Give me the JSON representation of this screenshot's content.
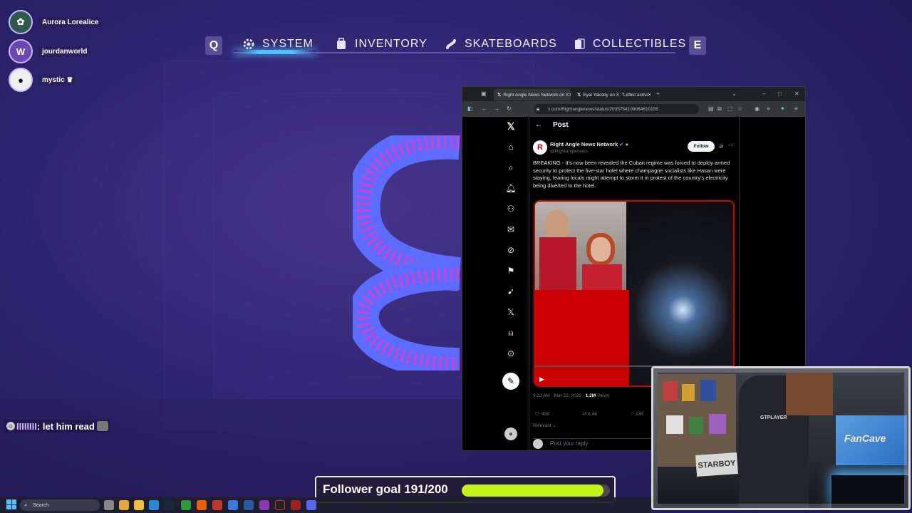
{
  "viewers": [
    {
      "name": "Aurora Lorealice"
    },
    {
      "name": "jourdanworld"
    },
    {
      "name": "mystic ♛"
    }
  ],
  "menu": {
    "left_key": "Q",
    "right_key": "E",
    "tabs": [
      {
        "label": "SYSTEM",
        "icon": "gear-icon",
        "active": true
      },
      {
        "label": "INVENTORY",
        "icon": "backpack-icon",
        "active": false
      },
      {
        "label": "SKATEBOARDS",
        "icon": "skateboard-icon",
        "active": false
      },
      {
        "label": "COLLECTIBLES",
        "icon": "cards-icon",
        "active": false
      }
    ],
    "accent_color": "#4fc3ff"
  },
  "browser": {
    "tabs": [
      {
        "title": "Right Angle News Network on X",
        "active": true
      },
      {
        "title": "Eyal Yakoby on X: \"Leftist activi",
        "active": false
      }
    ],
    "url": "x.com/Rightanglenews/status/2035754109064610155"
  },
  "x_post": {
    "header": "Post",
    "author_name": "Right Angle News Network",
    "author_handle": "@Rightanglenews",
    "follow_label": "Follow",
    "text": "BREAKING - It's now been revealed the Cuban regime was forced to deploy armed security to protect the five-star hotel where champagne socialists like Hasan were staying, fearing locals might attempt to storm it in protest of the country's electricity being diverted to the hotel.",
    "timestamp": "9:22 AM · Mar 22, 2026 · ",
    "views_count": "1.2M",
    "views_label": " Views",
    "replies": "499",
    "reposts": "6.4K",
    "likes": "33K",
    "sort_label": "Relevant ⌄",
    "reply_placeholder": "Post your reply"
  },
  "chat": {
    "user": "IIIIIIII",
    "message": "let him read"
  },
  "follower_goal": {
    "label": "Follower goal 191/200",
    "current": 191,
    "target": 200,
    "fill_color": "#c5f018"
  },
  "taskbar": {
    "search_placeholder": "Search"
  },
  "webcam": {
    "chair_brand": "GTPLAYER",
    "plate_text": "STARBOY",
    "poster_text": "FanCave"
  }
}
